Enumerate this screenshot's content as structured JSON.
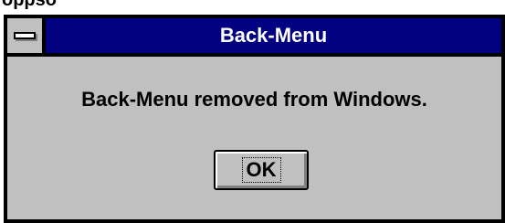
{
  "window": {
    "title": "Back-Menu",
    "partial_text_above": "oppso"
  },
  "dialog": {
    "message": "Back-Menu removed from Windows.",
    "ok_label": "OK"
  },
  "icons": {
    "system_menu": "system-menu-icon"
  },
  "colors": {
    "titlebar": "#000080",
    "title_text": "#ffffff",
    "dialog_bg": "#c0c0c0",
    "border": "#000000"
  }
}
